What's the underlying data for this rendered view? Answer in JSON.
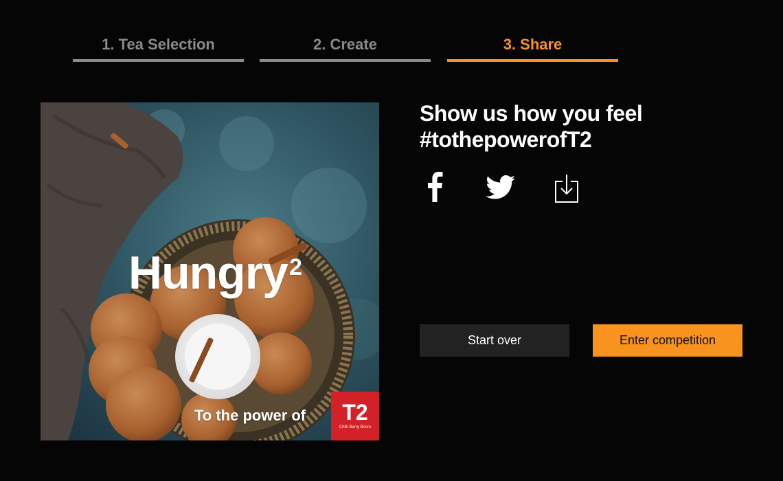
{
  "steps": [
    {
      "label": "1. Tea Selection",
      "active": false
    },
    {
      "label": "2. Create",
      "active": false
    },
    {
      "label": "3. Share",
      "active": true
    }
  ],
  "card": {
    "headline": "Hungry",
    "superscript": "2",
    "tagline": "To the power of",
    "brand": "T2",
    "flavour": "Chilli Berry Boom"
  },
  "share": {
    "headline_line1": "Show us how you feel",
    "headline_line2": "#tothepowerofT2",
    "icons": [
      "facebook-icon",
      "twitter-icon",
      "download-icon"
    ]
  },
  "buttons": {
    "start_over": "Start over",
    "enter_competition": "Enter competition"
  },
  "colors": {
    "accent": "#f7931e",
    "inactive_step": "#8a8a8a",
    "background": "#050505",
    "secondary_button": "#222222",
    "brand_red": "#d32128"
  }
}
